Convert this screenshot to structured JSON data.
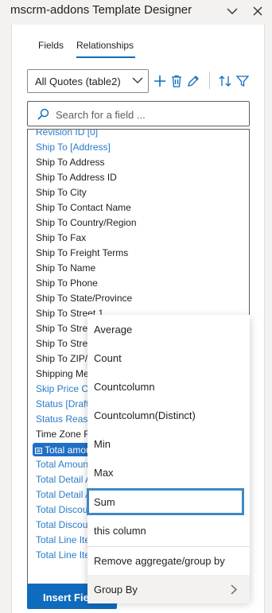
{
  "window": {
    "title": "mscrm-addons Template Designer"
  },
  "tabs": [
    {
      "label": "Fields"
    },
    {
      "label": "Relationships"
    }
  ],
  "toolbar": {
    "entity_select_value": "All Quotes (table2)"
  },
  "search": {
    "placeholder": "Search for a field ..."
  },
  "field_list": {
    "items": [
      {
        "label": "Revision ID [0]",
        "style": "link"
      },
      {
        "label": "Ship To [Address]",
        "style": "link"
      },
      {
        "label": "Ship To Address",
        "style": "plain"
      },
      {
        "label": "Ship To Address ID",
        "style": "plain"
      },
      {
        "label": "Ship To City",
        "style": "plain"
      },
      {
        "label": "Ship To Contact Name",
        "style": "plain"
      },
      {
        "label": "Ship To Country/Region",
        "style": "plain"
      },
      {
        "label": "Ship To Fax",
        "style": "plain"
      },
      {
        "label": "Ship To Freight Terms",
        "style": "plain"
      },
      {
        "label": "Ship To Name",
        "style": "plain"
      },
      {
        "label": "Ship To Phone",
        "style": "plain"
      },
      {
        "label": "Ship To State/Province",
        "style": "plain"
      },
      {
        "label": "Ship To Street 1",
        "style": "plain"
      },
      {
        "label": "Ship To Street 2",
        "style": "plain"
      },
      {
        "label": "Ship To Street 3",
        "style": "plain"
      },
      {
        "label": "Ship To ZIP/Postal Code",
        "style": "plain"
      },
      {
        "label": "Shipping Method",
        "style": "plain"
      },
      {
        "label": "Skip Price Calculation",
        "style": "link"
      },
      {
        "label": "Status [Draft]",
        "style": "link"
      },
      {
        "label": "Status Reason",
        "style": "link"
      },
      {
        "label": "Time Zone Rule Version Number",
        "style": "plain"
      },
      {
        "label": "Total amount",
        "style": "selected"
      },
      {
        "label": "Total Amount",
        "style": "link"
      },
      {
        "label": "Total Detail Amount",
        "style": "link"
      },
      {
        "label": "Total Detail Amount (Base)",
        "style": "link"
      },
      {
        "label": "Total Discount Amount",
        "style": "link"
      },
      {
        "label": "Total Discount Amount (Base)",
        "style": "link"
      },
      {
        "label": "Total Line Item Amount",
        "style": "link"
      },
      {
        "label": "Total Line Item Amount (Base)",
        "style": "link"
      }
    ]
  },
  "insert_button": {
    "label": "Insert Field"
  },
  "context_menu": {
    "items": [
      {
        "label": "Average"
      },
      {
        "label": "Count"
      },
      {
        "label": "Countcolumn"
      },
      {
        "label": "Countcolumn(Distinct)"
      },
      {
        "label": "Min"
      },
      {
        "label": "Max"
      },
      {
        "label": "Sum"
      },
      {
        "label": "this column"
      },
      {
        "label": "Remove aggregate/group by"
      },
      {
        "label": "Group By"
      }
    ],
    "focused": "Sum"
  },
  "colors": {
    "accent": "#0f6cbd",
    "link": "#2b7cc9",
    "focus_ring": "#3f88c5"
  }
}
